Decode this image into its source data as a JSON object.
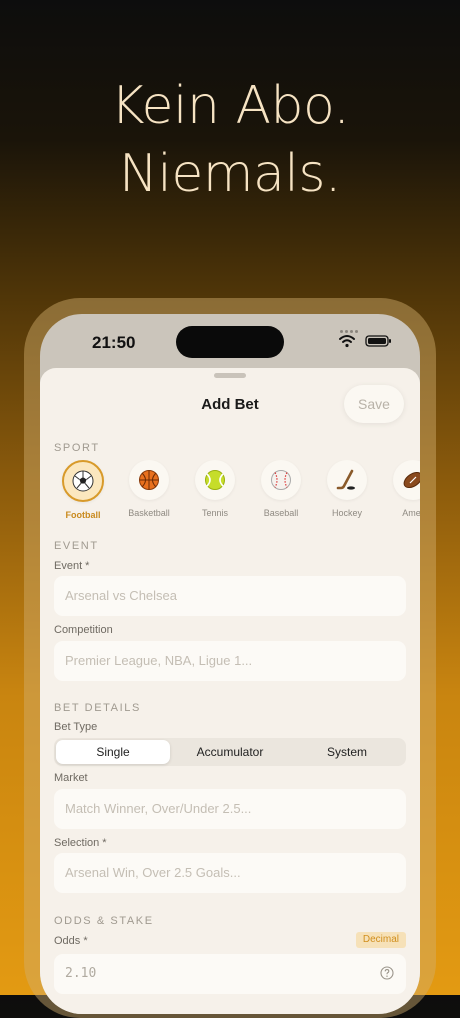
{
  "headline": {
    "line1": "Kein Abo.",
    "line2": "Niemals."
  },
  "status_bar": {
    "time": "21:50"
  },
  "sheet": {
    "title": "Add Bet",
    "save_label": "Save"
  },
  "sport_section": {
    "title": "SPORT",
    "items": [
      {
        "label": "Football",
        "icon": "soccer-ball-icon",
        "selected": true
      },
      {
        "label": "Basketball",
        "icon": "basketball-icon",
        "selected": false
      },
      {
        "label": "Tennis",
        "icon": "tennis-ball-icon",
        "selected": false
      },
      {
        "label": "Baseball",
        "icon": "baseball-icon",
        "selected": false
      },
      {
        "label": "Hockey",
        "icon": "hockey-stick-icon",
        "selected": false
      },
      {
        "label": "Amer",
        "icon": "american-football-icon",
        "selected": false
      }
    ]
  },
  "event_section": {
    "title": "EVENT",
    "event_label": "Event *",
    "event_placeholder": "Arsenal vs Chelsea",
    "competition_label": "Competition",
    "competition_placeholder": "Premier League, NBA, Ligue 1..."
  },
  "bet_details": {
    "title": "BET DETAILS",
    "bet_type_label": "Bet Type",
    "bet_types": [
      "Single",
      "Accumulator",
      "System"
    ],
    "selected_bet_type": "Single",
    "market_label": "Market",
    "market_placeholder": "Match Winner, Over/Under 2.5...",
    "selection_label": "Selection *",
    "selection_placeholder": "Arsenal Win, Over 2.5 Goals..."
  },
  "odds_stake": {
    "title": "ODDS & STAKE",
    "odds_label": "Odds *",
    "odds_format": "Decimal",
    "odds_placeholder": "2.10"
  },
  "colors": {
    "accent": "#d89a2a",
    "sheet_bg": "#f6f1ea",
    "headline": "#f6e3c3"
  }
}
